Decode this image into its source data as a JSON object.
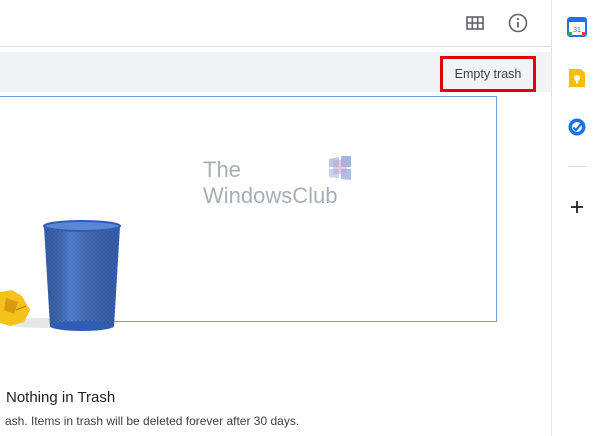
{
  "toolbar": {
    "icons": [
      "grid-view-icon",
      "info-icon"
    ]
  },
  "trash": {
    "empty_button_label": "Empty trash",
    "highlight_color": "#e10000"
  },
  "watermark": {
    "line1": "The",
    "line2": "WindowsClub"
  },
  "empty_state": {
    "title": "Nothing in Trash",
    "description": "ash. Items in trash will be deleted forever after 30 days."
  },
  "side_panel": {
    "icons": [
      "calendar-icon",
      "keep-icon",
      "tasks-icon",
      "add-icon"
    ],
    "calendar_day": "31"
  },
  "colors": {
    "accent_blue": "#1a73e8",
    "keep_yellow": "#fbbc04",
    "highlight_red": "#e10000"
  }
}
